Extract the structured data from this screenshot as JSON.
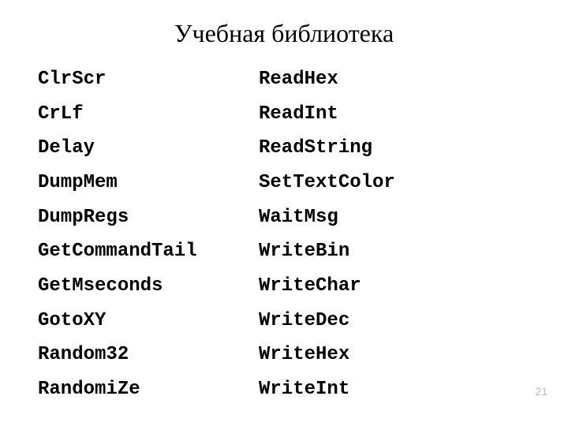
{
  "title": "Учебная библиотека",
  "left": {
    "i0": "ClrScr",
    "i1": "CrLf",
    "i2": "Delay",
    "i3": "DumpMem",
    "i4": "DumpRegs",
    "i5": "GetCommandTail",
    "i6": "GetMseconds",
    "i7": "GotoXY",
    "i8": "Random32",
    "i9": "RandomiZe"
  },
  "right": {
    "i0": "ReadHex",
    "i1": "ReadInt",
    "i2": "ReadString",
    "i3": "SetTextColor",
    "i4": "WaitMsg",
    "i5": "WriteBin",
    "i6": "WriteChar",
    "i7": "WriteDec",
    "i8": "WriteHex",
    "i9": "WriteInt"
  },
  "page_number": "21"
}
